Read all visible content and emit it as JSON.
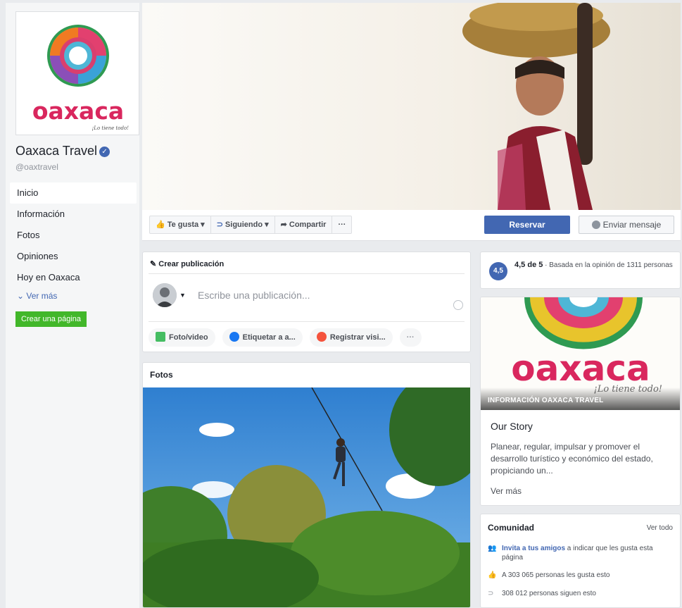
{
  "page": {
    "name": "Oaxaca Travel",
    "handle": "@oaxtravel",
    "logo_text": "oaxaca",
    "logo_tagline": "¡Lo tiene todo!"
  },
  "sidebar": {
    "items": [
      {
        "label": "Inicio",
        "active": true
      },
      {
        "label": "Información"
      },
      {
        "label": "Fotos"
      },
      {
        "label": "Opiniones"
      },
      {
        "label": "Hoy en Oaxaca"
      }
    ],
    "see_more": "Ver más",
    "create_page": "Crear una página"
  },
  "actionbar": {
    "like": "Te gusta",
    "following": "Siguiendo",
    "share": "Compartir",
    "more": "···",
    "reserve": "Reservar",
    "message": "Enviar mensaje"
  },
  "composer": {
    "title": "Crear publicación",
    "placeholder": "Escribe una publicación...",
    "actions": {
      "photo": "Foto/video",
      "tag": "Etiquetar a a...",
      "checkin": "Registrar visi...",
      "more": "···"
    }
  },
  "photos": {
    "title": "Fotos"
  },
  "rating": {
    "badge": "4,5",
    "score": "4,5 de 5",
    "separator": " · ",
    "detail": "Basada en la opinión de 1311 personas"
  },
  "about": {
    "overlay": "INFORMACIÓN OAXACA TRAVEL",
    "story_title": "Our Story",
    "story_text": "Planear, regular, impulsar y promover el desarrollo turístico y económico del estado, propiciando un...",
    "see_more": "Ver más"
  },
  "community": {
    "title": "Comunidad",
    "see_all": "Ver todo",
    "invite_link": "Invita a tus amigos",
    "invite_rest": " a indicar que les gusta esta página",
    "likes": "A 303 065 personas les gusta esto",
    "follows": "308 012 personas siguen esto"
  },
  "colors": {
    "brand_blue": "#4267b2",
    "green": "#42b72a",
    "background": "#e9ebee"
  }
}
